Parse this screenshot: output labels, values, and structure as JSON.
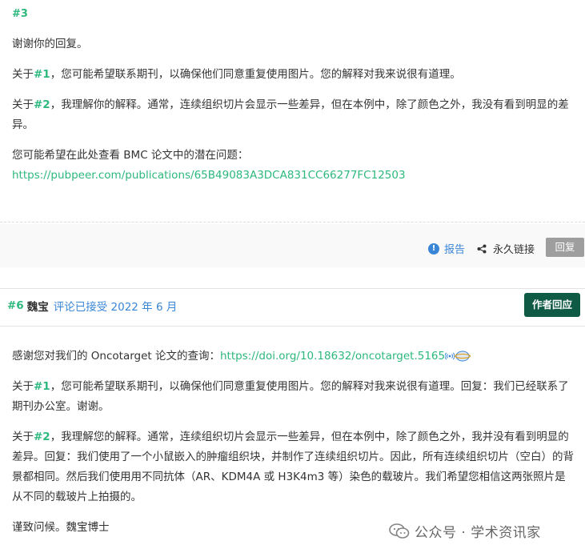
{
  "comment3": {
    "number": "#3",
    "greeting": "谢谢你的回复。",
    "p1": {
      "pre": "关于",
      "ref": "#1",
      "text": "，您可能希望联系期刊，以确保他们同意重复使用图片。您的解释对我来说很有道理。"
    },
    "p2": {
      "pre": "关于",
      "ref": "#2",
      "text": "，我理解你的解释。通常，连续组织切片会显示一些差异，但在本例中，除了颜色之外，我没有看到明显的差异。"
    },
    "p3": "您可能希望在此处查看 BMC 论文中的潜在问题：",
    "link": "https://pubpeer.com/publications/65B49083A3DCA831CC66277FC12503",
    "footer": {
      "report_label": "报告",
      "permalink_label": "永久链接",
      "reply_label": "回复"
    }
  },
  "comment6": {
    "number": "#6",
    "author": "魏宝",
    "accepted": "评论已接受 2022 年 6 月",
    "author_reply_label": "作者回应",
    "p1": {
      "text": "感谢您对我们的 Oncotarget 论文的查询：",
      "link": "https://doi.org/10.18632/oncotarget.5165"
    },
    "p2": {
      "pre": "关于",
      "ref": "#1",
      "text": "，您可能希望联系期刊，以确保他们同意重复使用图片。您的解释对我来说很有道理。回复：我们已经联系了期刊办公室。谢谢。"
    },
    "p3": {
      "pre": "关于",
      "ref": "#2",
      "text": "，我理解您的解释。通常，连续组织切片会显示一些差异，但在本例中，除了颜色之外，我并没有看到明显的差异。回复：我们使用了一个小鼠嵌入的肿瘤组织块，并制作了连续组织切片。因此，所有连续组织切片（空白）的背景都相同。然后我们使用用不同抗体（AR、KDM4A 或 H3K4m3 等）染色的载玻片。我们希望您相信这两张照片是从不同的载玻片上拍摄的。"
    },
    "p4": "谨致问候。魏宝博士"
  },
  "watermark": "公众号 · 学术资讯家",
  "colors": {
    "green": "#2db87d",
    "blue": "#3a86d6",
    "author_btn": "#0f5a44",
    "reply_btn": "#9e9e9e"
  }
}
